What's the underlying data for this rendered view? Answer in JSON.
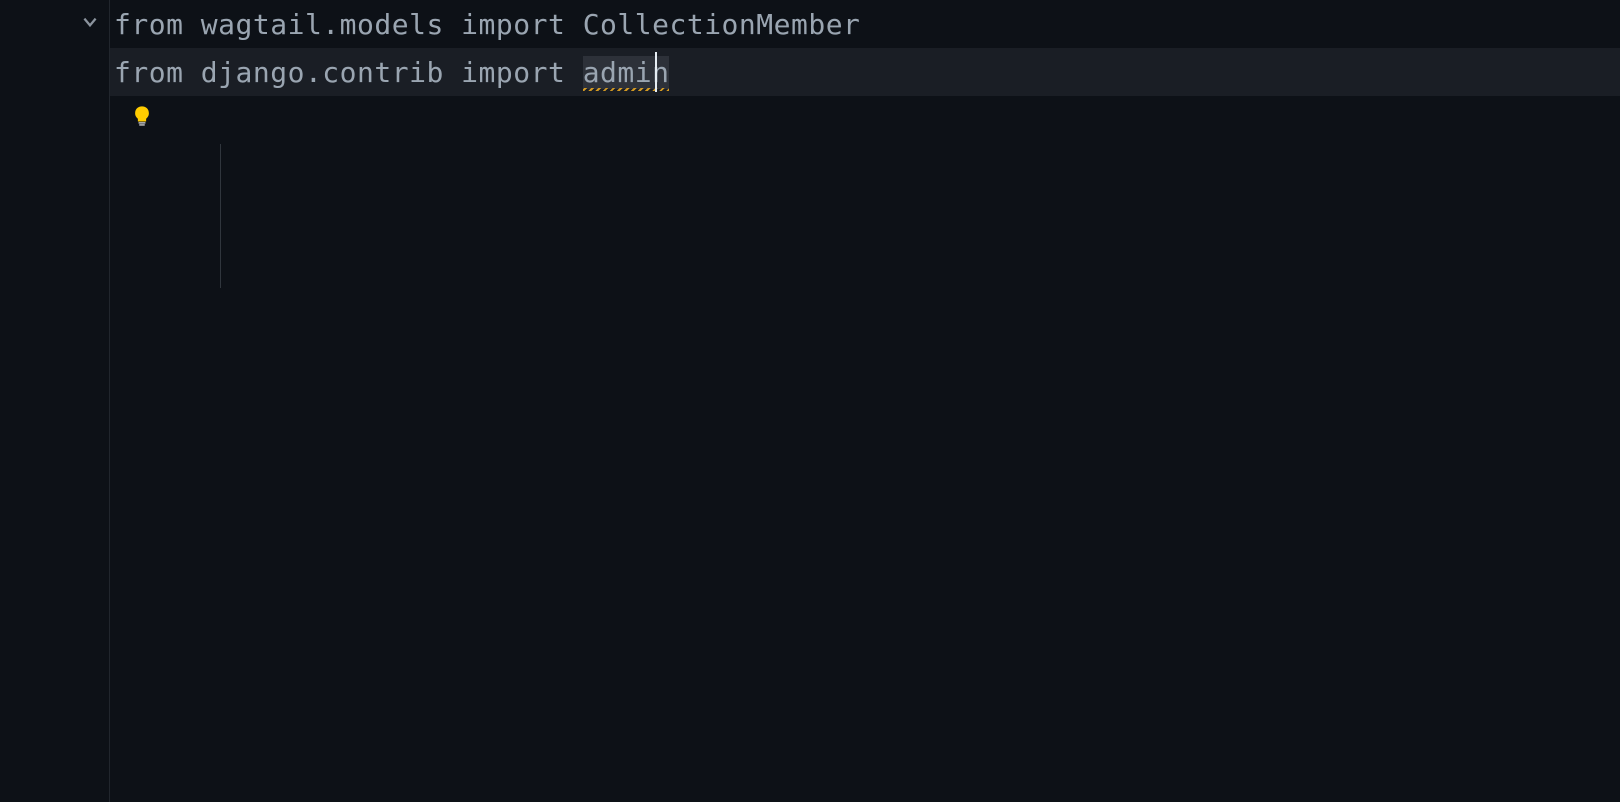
{
  "editor": {
    "lines": [
      {
        "segments": [
          {
            "text": "from ",
            "class": ""
          },
          {
            "text": "wagtail.models ",
            "class": ""
          },
          {
            "text": "import ",
            "class": ""
          },
          {
            "text": "CollectionMember",
            "class": ""
          }
        ],
        "folded": false,
        "hasFoldMarker": true
      },
      {
        "segments": [
          {
            "text": "from ",
            "class": ""
          },
          {
            "text": "django.contrib ",
            "class": ""
          },
          {
            "text": "import ",
            "class": ""
          },
          {
            "text": "admin",
            "class": "warning-underline highlighted-word"
          }
        ],
        "highlighted": true
      }
    ],
    "cursorLine": 1,
    "cursorColumn": 30
  },
  "icons": {
    "foldOpen": "chevron-down",
    "lightbulb": "lightbulb"
  }
}
